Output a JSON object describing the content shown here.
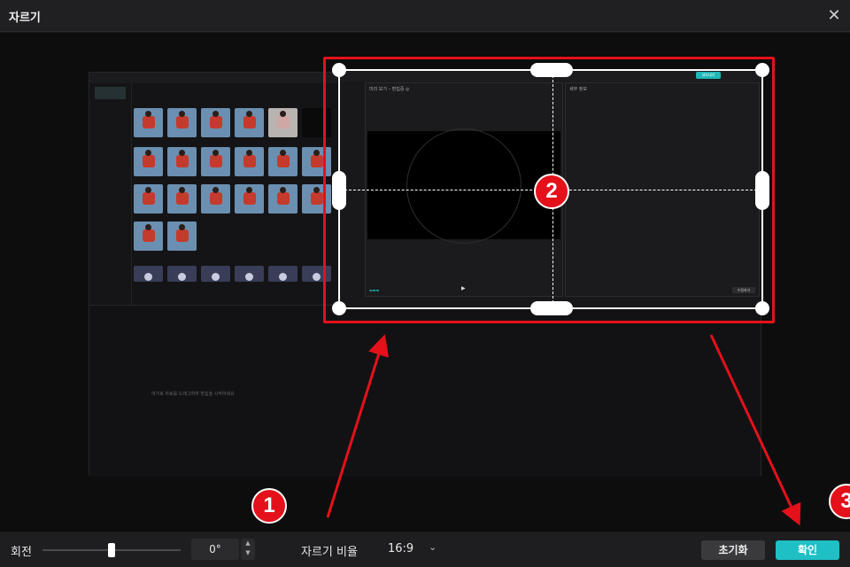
{
  "window": {
    "title": "자르기",
    "close_icon": "close-icon"
  },
  "preview": {
    "inner_export_label": "내보내기",
    "player_header": "미리 보기 – 편집중 ◎",
    "details_header": "세부 정보",
    "details_button": "수정하기",
    "timeline_hint": "여기로 자료를 드래그하여 편집을 시작하세요"
  },
  "bottom": {
    "rotation_label": "회전",
    "rotation_value": "0°",
    "rotation_slider_fraction": 0.5,
    "ratio_label": "자르기 비율",
    "ratio_value": "16:9",
    "reset_label": "초기화",
    "confirm_label": "확인"
  },
  "annotations": {
    "step1": "1",
    "step2": "2",
    "step3": "3",
    "color": "#e4111b"
  },
  "colors": {
    "accent": "#1fbfc6",
    "crop_frame": "#ffffff"
  }
}
